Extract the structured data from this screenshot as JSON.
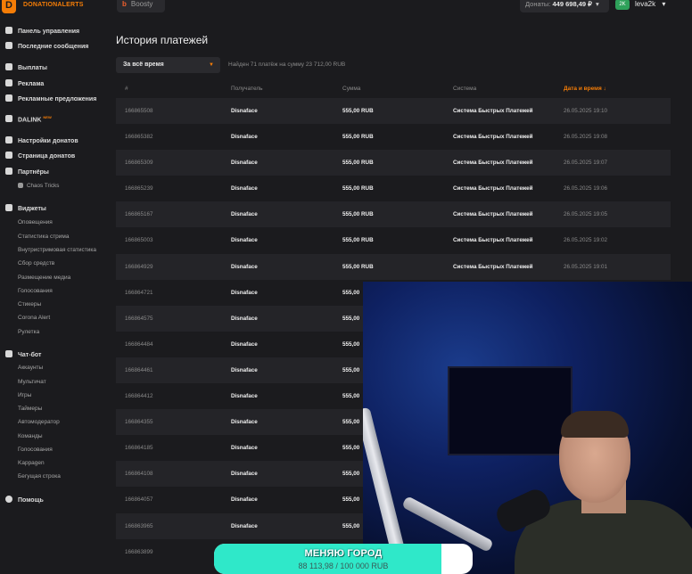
{
  "topbar": {
    "logo_text": "DONATIONALERTS",
    "boosty_label": "Boosty",
    "donations_label": "Донаты:",
    "donations_amount": "449 698,49 ₽",
    "user_name": "leva2k",
    "user_avatar_text": "2K"
  },
  "sidebar": {
    "items": [
      {
        "label": "Панель управления",
        "icon": "dashboard-icon"
      },
      {
        "label": "Последние сообщения",
        "icon": "messages-icon"
      },
      {
        "label": "Выплаты",
        "icon": "wallet-icon"
      },
      {
        "label": "Реклама",
        "icon": "megaphone-icon"
      },
      {
        "label": "Рекламные предложения",
        "icon": "briefcase-icon"
      },
      {
        "label": "DALINK",
        "badge": "NEW",
        "icon": "dalink-icon"
      },
      {
        "label": "Настройки донатов",
        "icon": "gear-icon"
      },
      {
        "label": "Страница донатов",
        "icon": "page-icon"
      },
      {
        "label": "Партнёры",
        "icon": "partners-icon"
      },
      {
        "label": "Chaos Tricks",
        "icon": "person-icon"
      },
      {
        "label": "Виджеты",
        "icon": "widgets-icon"
      },
      {
        "label": "Оповещения"
      },
      {
        "label": "Статистика стрима"
      },
      {
        "label": "Внутристримовая статистика"
      },
      {
        "label": "Сбор средств"
      },
      {
        "label": "Размещение медиа"
      },
      {
        "label": "Голосования"
      },
      {
        "label": "Стикеры"
      },
      {
        "label": "Corona Alert"
      },
      {
        "label": "Рулетка"
      },
      {
        "label": "Чат-бот",
        "icon": "chat-icon"
      },
      {
        "label": "Аккаунты"
      },
      {
        "label": "Мультичат"
      },
      {
        "label": "Игры"
      },
      {
        "label": "Таймеры"
      },
      {
        "label": "Автомодератор"
      },
      {
        "label": "Команды"
      },
      {
        "label": "Голосования"
      },
      {
        "label": "Kappagen"
      },
      {
        "label": "Бегущая строка"
      },
      {
        "label": "Помощь",
        "icon": "help-icon"
      }
    ]
  },
  "main": {
    "title": "История платежей",
    "filter_value": "За всё время",
    "found_text": "Найден 71 платёж на сумму 23 712,00 RUB",
    "columns": [
      "#",
      "Получатель",
      "Сумма",
      "Система",
      "Дата и время ↓"
    ],
    "rows": [
      {
        "id": "166865508",
        "to": "Disnaface",
        "sum": "555,00 RUB",
        "sys": "Система Быстрых Платежей",
        "date": "26.05.2025 19:10"
      },
      {
        "id": "166865382",
        "to": "Disnaface",
        "sum": "555,00 RUB",
        "sys": "Система Быстрых Платежей",
        "date": "26.05.2025 19:08"
      },
      {
        "id": "166865309",
        "to": "Disnaface",
        "sum": "555,00 RUB",
        "sys": "Система Быстрых Платежей",
        "date": "26.05.2025 19:07"
      },
      {
        "id": "166865239",
        "to": "Disnaface",
        "sum": "555,00 RUB",
        "sys": "Система Быстрых Платежей",
        "date": "26.05.2025 19:06"
      },
      {
        "id": "166865167",
        "to": "Disnaface",
        "sum": "555,00 RUB",
        "sys": "Система Быстрых Платежей",
        "date": "26.05.2025 19:05"
      },
      {
        "id": "166865003",
        "to": "Disnaface",
        "sum": "555,00 RUB",
        "sys": "Система Быстрых Платежей",
        "date": "26.05.2025 19:02"
      },
      {
        "id": "166864929",
        "to": "Disnaface",
        "sum": "555,00 RUB",
        "sys": "Система Быстрых Платежей",
        "date": "26.05.2025 19:01"
      },
      {
        "id": "166864721",
        "to": "Disnaface",
        "sum": "555,00",
        "sys": "",
        "date": ""
      },
      {
        "id": "166864575",
        "to": "Disnaface",
        "sum": "555,00",
        "sys": "",
        "date": ""
      },
      {
        "id": "166864484",
        "to": "Disnaface",
        "sum": "555,00",
        "sys": "",
        "date": ""
      },
      {
        "id": "166864461",
        "to": "Disnaface",
        "sum": "555,00",
        "sys": "",
        "date": ""
      },
      {
        "id": "166864412",
        "to": "Disnaface",
        "sum": "555,00",
        "sys": "",
        "date": ""
      },
      {
        "id": "166864355",
        "to": "Disnaface",
        "sum": "555,00",
        "sys": "",
        "date": ""
      },
      {
        "id": "166864185",
        "to": "Disnaface",
        "sum": "555,00",
        "sys": "",
        "date": ""
      },
      {
        "id": "166864108",
        "to": "Disnaface",
        "sum": "555,00",
        "sys": "",
        "date": ""
      },
      {
        "id": "166864057",
        "to": "Disnaface",
        "sum": "555,00",
        "sys": "",
        "date": ""
      },
      {
        "id": "166863965",
        "to": "Disnaface",
        "sum": "555,00",
        "sys": "",
        "date": ""
      },
      {
        "id": "166863899",
        "to": "",
        "sum": "",
        "sys": "",
        "date": ""
      }
    ]
  },
  "goal": {
    "title": "МЕНЯЮ ГОРОД",
    "amount_text": "88 113,98 / 100 000 RUB",
    "progress": 0.88,
    "fill_color": "#2fe8c9"
  },
  "colors": {
    "accent": "#f57d07",
    "background": "#1b1b1e",
    "row_alt": "#242428"
  }
}
